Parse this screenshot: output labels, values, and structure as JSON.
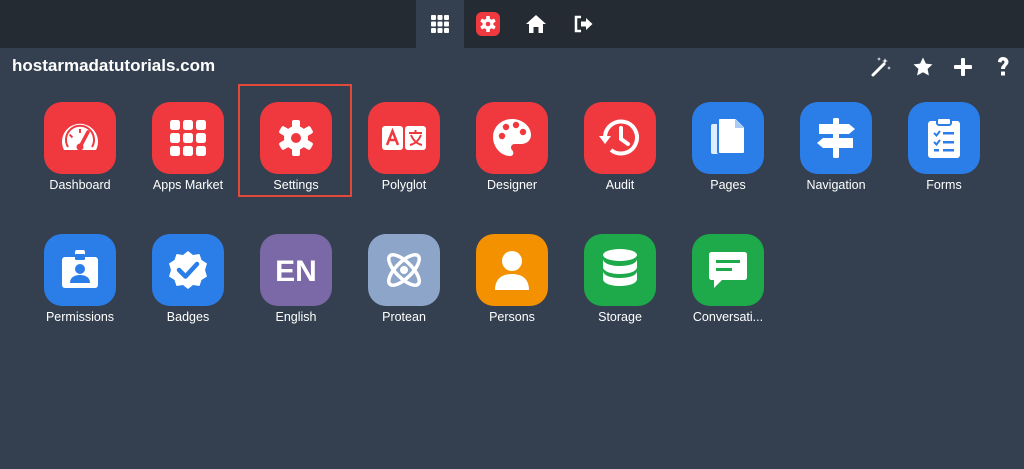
{
  "site": {
    "title": "hostarmadatutorials.com"
  },
  "topbar": {
    "items": [
      {
        "icon": "apps-grid-icon",
        "active": true
      },
      {
        "icon": "gear-icon"
      },
      {
        "icon": "home-icon"
      },
      {
        "icon": "logout-icon"
      }
    ]
  },
  "toolbar": {
    "items": [
      {
        "icon": "magic-wand-icon"
      },
      {
        "icon": "star-icon"
      },
      {
        "icon": "plus-icon"
      },
      {
        "icon": "help-icon"
      }
    ]
  },
  "apps": [
    {
      "label": "Dashboard",
      "icon": "gauge-icon",
      "color": "#f0393f"
    },
    {
      "label": "Apps Market",
      "icon": "apps-grid-icon",
      "color": "#f0393f"
    },
    {
      "label": "Settings",
      "icon": "gear-icon",
      "color": "#f0393f",
      "selected": true
    },
    {
      "label": "Polyglot",
      "icon": "translate-icon",
      "color": "#f0393f"
    },
    {
      "label": "Designer",
      "icon": "palette-icon",
      "color": "#f0393f"
    },
    {
      "label": "Audit",
      "icon": "history-icon",
      "color": "#f0393f"
    },
    {
      "label": "Pages",
      "icon": "pages-icon",
      "color": "#2b7ee8"
    },
    {
      "label": "Navigation",
      "icon": "signpost-icon",
      "color": "#2b7ee8"
    },
    {
      "label": "Forms",
      "icon": "clipboard-icon",
      "color": "#2b7ee8"
    },
    {
      "label": "Permissions",
      "icon": "id-badge-icon",
      "color": "#2b7ee8"
    },
    {
      "label": "Badges",
      "icon": "verified-badge-icon",
      "color": "#2b7ee8"
    },
    {
      "label": "English",
      "icon": "language-en-icon",
      "color": "#7b68a6",
      "icon_text": "EN"
    },
    {
      "label": "Protean",
      "icon": "atom-icon",
      "color": "#8da5c9"
    },
    {
      "label": "Persons",
      "icon": "person-icon",
      "color": "#f39100"
    },
    {
      "label": "Storage",
      "icon": "database-icon",
      "color": "#1ea94a"
    },
    {
      "label": "Conversati...",
      "icon": "chat-icon",
      "color": "#1ea94a"
    }
  ]
}
